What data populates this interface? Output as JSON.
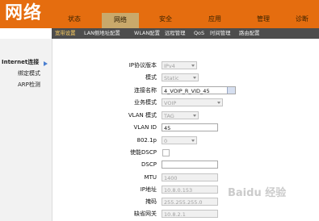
{
  "header": {
    "title": "网络",
    "tabs": [
      {
        "label": "状态"
      },
      {
        "label": "网络"
      },
      {
        "label": "安全"
      },
      {
        "label": "应用"
      },
      {
        "label": "管理"
      },
      {
        "label": "诊断"
      }
    ],
    "active_tab": "网络"
  },
  "subnav": {
    "items": [
      {
        "label": "宽带设置"
      },
      {
        "label": "LAN侧地址配置"
      },
      {
        "label": "WLAN配置"
      },
      {
        "label": "远程管理"
      },
      {
        "label": "QoS"
      },
      {
        "label": "时间管理"
      },
      {
        "label": "路由配置"
      }
    ],
    "active": "宽带设置"
  },
  "sidebar": {
    "items": [
      {
        "label": "Internet连接"
      },
      {
        "label": "绑定模式"
      },
      {
        "label": "ARP检测"
      }
    ],
    "active": "Internet连接"
  },
  "form": {
    "ip_version": {
      "label": "IP协议版本",
      "value": "IPv4"
    },
    "mode": {
      "label": "模式",
      "value": "Static"
    },
    "connection_name": {
      "label": "连接名称",
      "value": "4_VOIP_R_VID_45"
    },
    "service_mode": {
      "label": "业务模式",
      "value": "VOIP"
    },
    "vlan_mode": {
      "label": "VLAN 模式",
      "value": "TAG"
    },
    "vlan_id": {
      "label": "VLAN ID",
      "value": "45"
    },
    "priority": {
      "label": "802.1p",
      "value": "0"
    },
    "enable_dscp": {
      "label": "使能DSCP",
      "checked": false
    },
    "dscp": {
      "label": "DSCP",
      "value": ""
    },
    "mtu": {
      "label": "MTU",
      "value": "1400"
    },
    "ip_address": {
      "label": "IP地址",
      "value": "10.8.0.153"
    },
    "subnet_mask": {
      "label": "掩码",
      "value": "255.255.255.0"
    },
    "default_gateway": {
      "label": "缺省网关",
      "value": "10.8.2.1"
    }
  },
  "watermark": "Baidu 经验",
  "colors": {
    "header_orange": "#e56d0f",
    "active_tab": "#c9a96b",
    "subnav_bg": "#4d4d4d",
    "sidebar_bg": "#f2f2f2"
  }
}
